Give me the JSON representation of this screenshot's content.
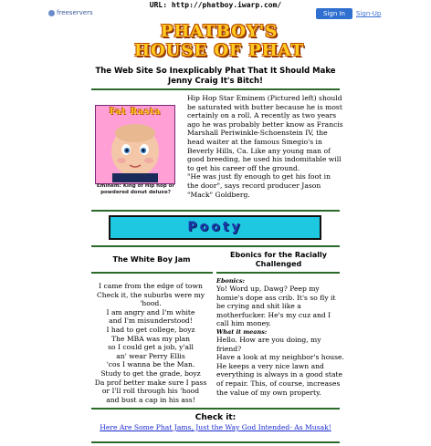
{
  "url_bar": {
    "text": "URL: http://phatboy.iwarp.com/"
  },
  "host_bar": {
    "logo_text": "freeservers",
    "sign_in_label": "Sign In",
    "sign_up_label": "Sign-Up"
  },
  "logo": {
    "line1": "PHATBOY'S",
    "line2": "HOUSE OF PHAT"
  },
  "tagline": "The Web Site So Inexplicably Phat That It Should Make Jenny Craig It's Bitch!",
  "feature": {
    "photo_title": "Fat Rasta",
    "photo_caption": "Eminem: King of Hip hop or powdered donut deluxe?",
    "story": "Hip Hop Star Eminem (Pictured left) should be saturated with butter because he is most certainly on a roll.  A recently as two years ago he was probably better know as Francis Marshall Periwinkle-Schoenstein IV, the  head waiter at the famous Smegio's in Beverly Hills, Ca.  Like any young man of good breeding, he used his indomitable will to get his career off the ground.",
    "quote": " \"He was just fly enough to get his foot in the door\", says record producer Jason \"Mack\" Goldberg."
  },
  "banner": {
    "label": "Pooty"
  },
  "columns": {
    "left_title": "The White Boy Jam",
    "right_title": "Ebonics for the Racially Challenged"
  },
  "poem": [
    "I came from the edge of town",
    "Check it, the suburbs were my",
    "'hood.",
    "I am angry and I'm white",
    "and I'm misunderstood!",
    "I had to get college, boyz",
    "The MBA was my plan",
    "so I could get a job, y'all",
    "an' wear Perry Ellis",
    "'cos I wanna be the Man.",
    "Study to get the grade, boyz",
    "Da prof better make sure I pass",
    "or I'll roll through his 'hood",
    "and bust a cap in his ass!"
  ],
  "ebonics": {
    "tag1": "Ebonics:",
    "text1": "Yo! Word up, Dawg?  Peep my homie's dope ass crib.  It's so fly it be crying and shit like a motherfucker. He's my cuz and I call him money.",
    "tag2": "What it means:",
    "text2": "Hello.  How are you doing, my friend?",
    "text3": "Have a look at  my neighbor's house.  He keeps a very nice lawn and everything is always in a good state of repair.  This, of course, increases the value of my own property."
  },
  "check_it": {
    "title": "Check it:",
    "link": "Here Are Some Phat Jams, Just the Way God Intended- As Musak!"
  }
}
